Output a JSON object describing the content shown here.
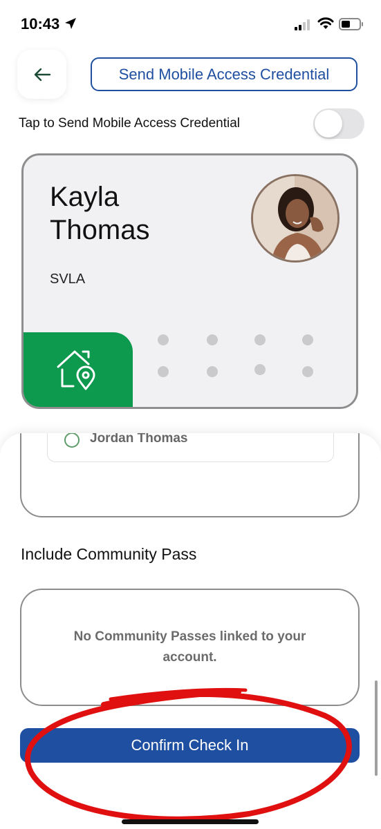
{
  "status_bar": {
    "time": "10:43",
    "icons": [
      "location-arrow-icon",
      "cellular-signal-icon",
      "wifi-icon",
      "battery-icon"
    ]
  },
  "header": {
    "back_icon": "arrow-left-icon",
    "title": "Send Mobile Access Credential"
  },
  "toggle": {
    "label": "Tap to Send Mobile Access Credential",
    "on": false
  },
  "card": {
    "first_name": "Kayla",
    "last_name": "Thomas",
    "org": "SVLA",
    "icon": "home-location-icon",
    "accent_color": "#0e9a4e"
  },
  "resident_list": {
    "items": [
      {
        "name": "Jordan Thomas",
        "selected": false
      }
    ]
  },
  "community_pass": {
    "title": "Include Community Pass",
    "empty_message": "No Community Passes linked to your account."
  },
  "confirm_button": {
    "label": "Confirm Check In",
    "color": "#1f4fa0"
  },
  "annotation_color": "#e01010"
}
